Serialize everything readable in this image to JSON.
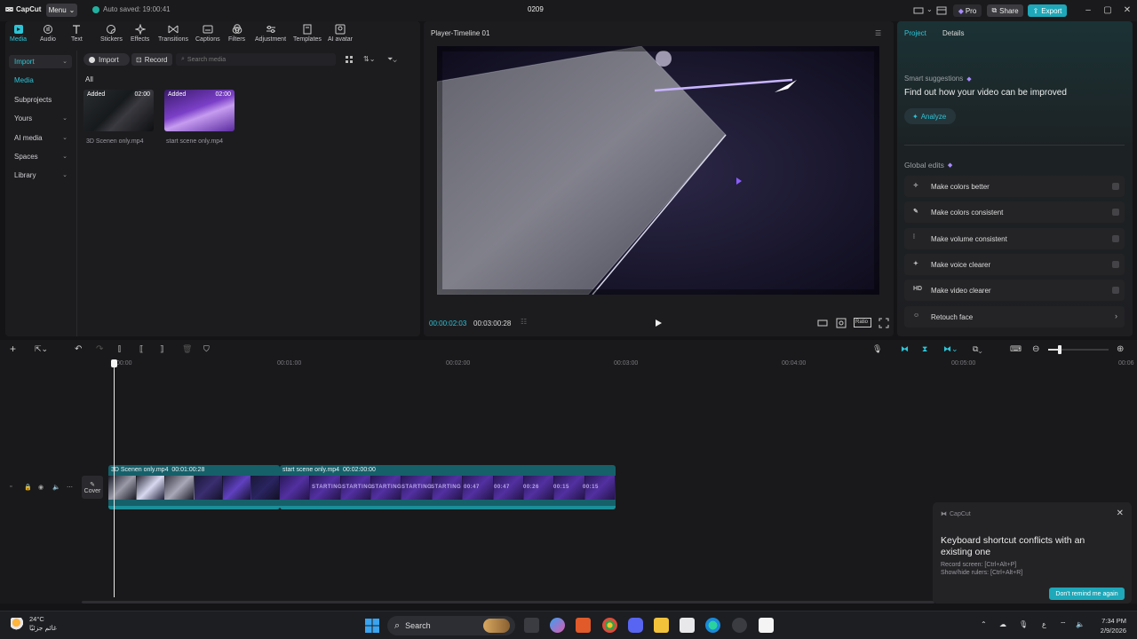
{
  "app": {
    "name": "CapCut",
    "menu_label": "Menu",
    "autosave": "Auto saved: 19:00:41",
    "project_name": "0209",
    "pro_label": "Pro",
    "share_label": "Share",
    "export_label": "Export"
  },
  "toolbar": {
    "tools": [
      "Media",
      "Audio",
      "Text",
      "Stickers",
      "Effects",
      "Transitions",
      "Captions",
      "Filters",
      "Adjustment",
      "Templates",
      "AI avatar"
    ]
  },
  "sidebar": {
    "items": [
      {
        "label": "Import"
      },
      {
        "label": "Media"
      },
      {
        "label": "Subprojects"
      },
      {
        "label": "Yours"
      },
      {
        "label": "AI media"
      },
      {
        "label": "Spaces"
      },
      {
        "label": "Library"
      }
    ]
  },
  "media": {
    "import_label": "Import",
    "record_label": "Record",
    "search_placeholder": "Search media",
    "filter_all": "All",
    "items": [
      {
        "tag": "Added",
        "duration": "02:00",
        "name": "3D Scenen only.mp4"
      },
      {
        "tag": "Added",
        "duration": "02:00",
        "name": "start scene only.mp4"
      }
    ]
  },
  "player": {
    "title": "Player-Timeline 01",
    "current_time": "00:00:02:03",
    "total_time": "00:03:00:28",
    "ratio_label": "Ratio"
  },
  "right_panel": {
    "tabs": [
      "Project",
      "Details"
    ],
    "smart_label": "Smart suggestions",
    "find_out": "Find out how your video can be improved",
    "analyze_label": "Analyze",
    "global_label": "Global edits",
    "edits": [
      {
        "label": "Make colors better",
        "icon": "sparkle-icon"
      },
      {
        "label": "Make colors consistent",
        "icon": "brush-icon"
      },
      {
        "label": "Make volume consistent",
        "icon": "equalizer-icon"
      },
      {
        "label": "Make voice clearer",
        "icon": "sparkle-icon"
      },
      {
        "label": "Make video clearer",
        "icon": "hd-icon",
        "icon_text": "HD"
      },
      {
        "label": "Retouch face",
        "icon": "face-icon"
      }
    ]
  },
  "timeline": {
    "ruler": [
      "00:00",
      "00:01:00",
      "00:02:00",
      "00:03:00",
      "00:04:00",
      "00:05:00",
      "00:06"
    ],
    "cover_label": "Cover",
    "clips": [
      {
        "name": "3D Scenen only.mp4",
        "duration": "00:01:00:28"
      },
      {
        "name": "start scene only.mp4",
        "duration": "00:02:00:00"
      }
    ],
    "frame_texts": [
      "STARTING",
      "STARTING",
      "STARTING",
      "STARTING",
      "STARTING",
      "00:47",
      "00:47",
      "00:26",
      "00:15",
      "00:15"
    ]
  },
  "toast": {
    "app": "CapCut",
    "title": "Keyboard shortcut conflicts with an existing one",
    "line1": "Record screen: [Ctrl+Alt+P]",
    "line2": "Show/hide rulers: [Ctrl+Alt+R]",
    "button": "Don't remind me again"
  },
  "taskbar": {
    "temperature": "24°C",
    "weather_text": "غائم جزئيًا",
    "search_label": "Search",
    "time": "7:34 PM",
    "date": "2/9/2026",
    "lang": "ع"
  }
}
